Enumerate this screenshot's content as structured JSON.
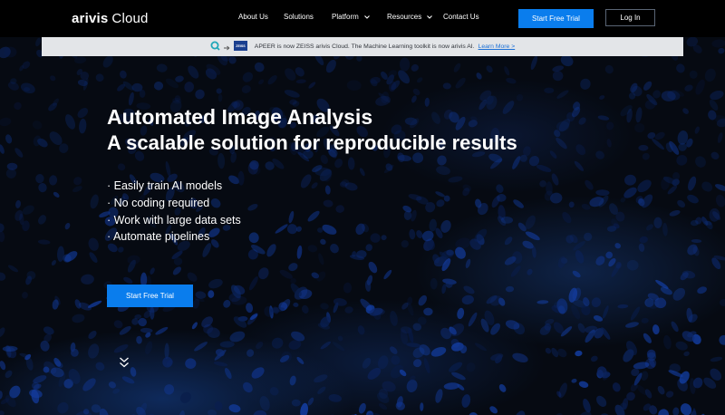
{
  "header": {
    "logo_brand": "arivis",
    "logo_product": "Cloud",
    "nav": [
      {
        "label": "About Us",
        "has_dropdown": false
      },
      {
        "label": "Solutions",
        "has_dropdown": false
      },
      {
        "label": "Platform",
        "has_dropdown": true
      },
      {
        "label": "Resources",
        "has_dropdown": true
      },
      {
        "label": "Contact Us",
        "has_dropdown": false
      }
    ],
    "cta_label": "Start Free Trial",
    "login_label": "Log In"
  },
  "banner": {
    "text": "APEER is now ZEISS arivis Cloud. The Machine Learning toolkit is now arivis AI.",
    "link_label": "Learn More >",
    "icons": [
      "apeer-logo-icon",
      "arrow-right-icon",
      "zeiss-logo-icon"
    ],
    "zeiss_wordmark": "ZEISS"
  },
  "hero": {
    "title": "Automated Image Analysis",
    "subtitle": "A scalable solution for reproducible results",
    "features": [
      "· Easily train AI models",
      "· No coding required",
      "· Work with large data sets",
      "· Automate pipelines"
    ],
    "cta_label": "Start Free Trial",
    "scroll_icon": "double-chevron-down-icon"
  },
  "colors": {
    "accent": "#0a7ded",
    "navbar_bg": "#000000",
    "banner_bg": "#e3e5e8",
    "link": "#1a6fd6",
    "apeer_teal": "#1fa7b8",
    "zeiss_blue": "#1a3f8f"
  }
}
